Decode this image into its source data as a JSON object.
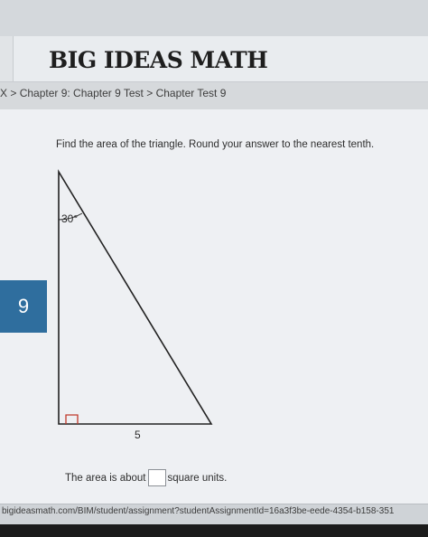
{
  "header": {
    "brand": "BIG IDEAS MATH"
  },
  "breadcrumb": {
    "prefix": "X > ",
    "chapter": "Chapter 9: Chapter 9 Test",
    "separator": " > ",
    "current": "Chapter Test 9"
  },
  "question": {
    "number": "9",
    "prompt": "Find the area of the triangle. Round your answer to the nearest tenth.",
    "angle_label": "30°",
    "side_label": "5",
    "answer_prefix": "The area is about",
    "answer_value": "",
    "answer_suffix": "square units."
  },
  "status": {
    "url": "bigideasmath.com/BIM/student/assignment?studentAssignmentId=16a3f3be-eede-4354-b158-351"
  },
  "colors": {
    "accent": "#2f6e9e",
    "right_angle_marker": "#c0392b"
  }
}
